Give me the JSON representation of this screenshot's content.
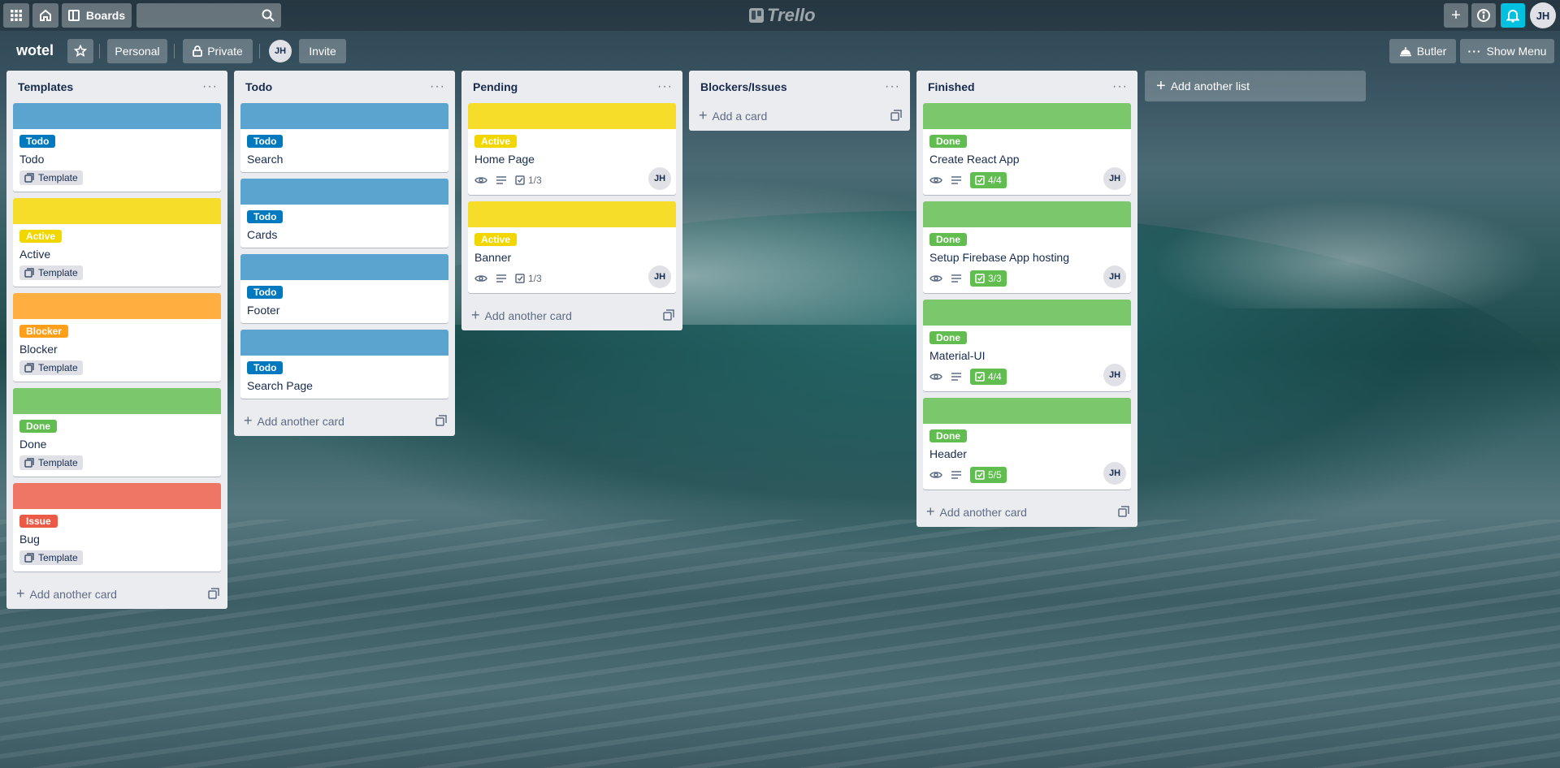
{
  "colors": {
    "todo": "#0079bf",
    "active": "#f2d600",
    "blocker": "#ff9f1a",
    "done": "#61bd4f",
    "issue": "#eb5a46",
    "notif": "#00c2e0"
  },
  "header": {
    "apps_icon": "grid-icon",
    "home_icon": "home-icon",
    "boards_label": "Boards",
    "search_icon": "search-icon",
    "logo_text": "Trello",
    "create_icon": "plus-icon",
    "info_icon": "info-icon",
    "notifications_icon": "bell-icon",
    "user_initials": "JH"
  },
  "board": {
    "title": "wotel",
    "personal_label": "Personal",
    "private_label": "Private",
    "member_initials": "JH",
    "invite_label": "Invite",
    "butler_label": "Butler",
    "show_menu_label": "Show Menu"
  },
  "lists": {
    "templates": {
      "title": "Templates",
      "cards": [
        {
          "label": "Todo",
          "title": "Todo",
          "badge": "Template"
        },
        {
          "label": "Active",
          "title": "Active",
          "badge": "Template"
        },
        {
          "label": "Blocker",
          "title": "Blocker",
          "badge": "Template"
        },
        {
          "label": "Done",
          "title": "Done",
          "badge": "Template"
        },
        {
          "label": "Issue",
          "title": "Bug",
          "badge": "Template"
        }
      ],
      "add_card": "Add another card"
    },
    "todo": {
      "title": "Todo",
      "cards": [
        {
          "label": "Todo",
          "title": "Search"
        },
        {
          "label": "Todo",
          "title": "Cards"
        },
        {
          "label": "Todo",
          "title": "Footer"
        },
        {
          "label": "Todo",
          "title": "Search Page"
        }
      ],
      "add_card": "Add another card"
    },
    "pending": {
      "title": "Pending",
      "cards": [
        {
          "label": "Active",
          "title": "Home Page",
          "checklist": "1/3",
          "member": "JH"
        },
        {
          "label": "Active",
          "title": "Banner",
          "checklist": "1/3",
          "member": "JH"
        }
      ],
      "add_card": "Add another card"
    },
    "blockers": {
      "title": "Blockers/Issues",
      "add_card": "Add a card"
    },
    "finished": {
      "title": "Finished",
      "cards": [
        {
          "label": "Done",
          "title": "Create React App",
          "checklist": "4/4",
          "member": "JH"
        },
        {
          "label": "Done",
          "title": "Setup Firebase App hosting",
          "checklist": "3/3",
          "member": "JH"
        },
        {
          "label": "Done",
          "title": "Material-UI",
          "checklist": "4/4",
          "member": "JH"
        },
        {
          "label": "Done",
          "title": "Header",
          "checklist": "5/5",
          "member": "JH"
        }
      ],
      "add_card": "Add another card"
    }
  },
  "add_list": "Add another list"
}
